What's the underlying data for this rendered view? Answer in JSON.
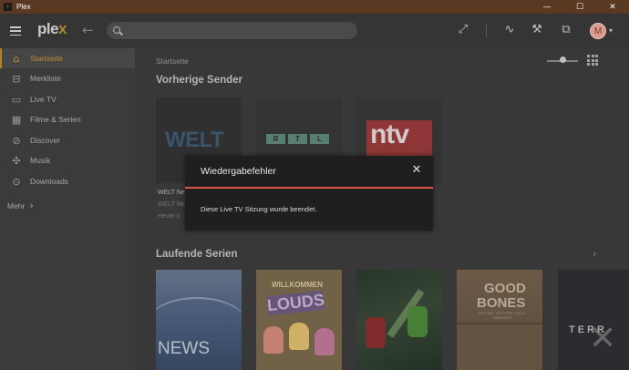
{
  "window": {
    "title": "Plex",
    "controls": {
      "minimize": "—",
      "maximize": "☐",
      "close": "✕"
    }
  },
  "topbar": {
    "logo_main": "ple",
    "logo_x": "x",
    "avatar_initial": "M",
    "icons": [
      "menu-icon",
      "back-arrow-icon",
      "search-icon",
      "fullscreen-icon",
      "activity-icon",
      "settings-wrench-icon",
      "cast-icon",
      "avatar",
      "chevron-down-icon"
    ]
  },
  "sidebar": {
    "items": [
      {
        "label": "Startseite",
        "icon": "⌂",
        "active": true
      },
      {
        "label": "Merkliste",
        "icon": "⊟"
      },
      {
        "label": "Live TV",
        "icon": "▭"
      },
      {
        "label": "Filme & Serien",
        "icon": "▦"
      },
      {
        "label": "Discover",
        "icon": "⊘"
      },
      {
        "label": "Musik",
        "icon": "✣"
      },
      {
        "label": "Downloads",
        "icon": "⊙"
      }
    ],
    "more_label": "Mehr",
    "more_chevron": "›"
  },
  "main": {
    "breadcrumb": "Startseite",
    "previous_channels_title": "Vorherige Sender",
    "channels": [
      {
        "logo": "WELT",
        "title": "WELT Ne",
        "line1": "WELT Ne",
        "line2": "Heute u"
      },
      {
        "logo_letters": [
          "R",
          "T",
          "L"
        ]
      },
      {
        "logo": "ntv"
      }
    ],
    "series_title": "Laufende Serien",
    "series_chevron": "›",
    "posters": [
      {
        "text": "NEWS"
      },
      {
        "top": "WILLKOMMEN",
        "title": "LOUDS"
      },
      {
        "title": ""
      },
      {
        "title1": "GOOD",
        "title2": "BONES",
        "subtitle": "MUTTER, TOCHTER, HAUS-SANIERER"
      },
      {
        "title": "TERR"
      }
    ]
  },
  "modal": {
    "title": "Wiedergabefehler",
    "close": "✕",
    "message": "Diese Live TV Sitzung wurde beendet.",
    "accent_color": "#d4573e"
  },
  "colors": {
    "accent": "#c99a3a",
    "titlebar": "#5a3922"
  }
}
